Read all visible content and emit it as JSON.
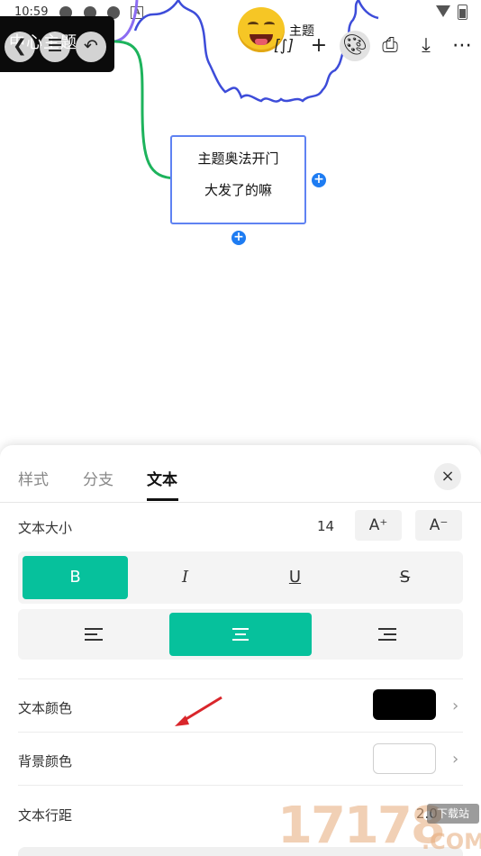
{
  "status_bar": {
    "time": "10:59",
    "a_label": "A"
  },
  "nav": {
    "behind_text": "中心主题"
  },
  "root_topic": {
    "label": "主题"
  },
  "toolbar": {
    "formula_label": "[∫]"
  },
  "topic": {
    "line1": "主题奥法开门",
    "line2": "大发了的嘛"
  },
  "sheet": {
    "tabs": [
      {
        "label": "样式"
      },
      {
        "label": "分支"
      },
      {
        "label": "文本",
        "active": true
      }
    ],
    "close": "×",
    "text_size": {
      "label": "文本大小",
      "value": "14",
      "increase": "A⁺",
      "decrease": "A⁻"
    },
    "styles": {
      "bold": "B",
      "italic": "I",
      "underline": "U",
      "strike": "S",
      "selected": "bold"
    },
    "alignment": {
      "selected": "center"
    },
    "text_color": {
      "label": "文本颜色",
      "color": "#000000"
    },
    "bg_color": {
      "label": "背景颜色",
      "color": "#ffffff"
    },
    "line_spacing": {
      "label": "文本行距",
      "value": "2.0"
    }
  },
  "colors": {
    "accent": "#06c19c",
    "node_border": "#5f82f2",
    "branch_green": "#1db35c",
    "cloud_stroke": "#3d4cd9",
    "branch_purple": "#8b6cf2"
  },
  "watermark": {
    "digits": "17178",
    "badge": "下载站",
    "suffix": ".COM"
  }
}
